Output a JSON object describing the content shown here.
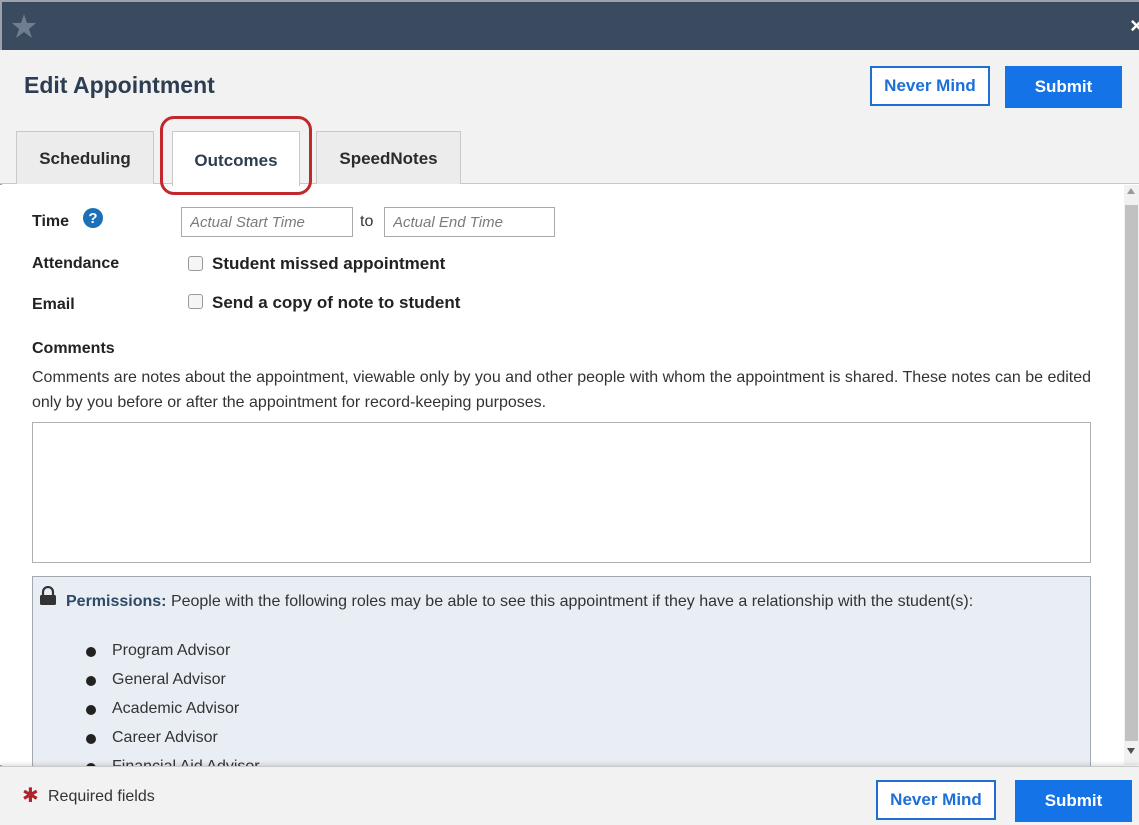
{
  "window": {
    "logo_icon": "star-logo-icon",
    "close_label": "×"
  },
  "header": {
    "title": "Edit Appointment",
    "never_mind_label": "Never Mind",
    "submit_label": "Submit",
    "accent_color": "#1473e6",
    "bar_color": "#3a4a5f"
  },
  "tabs": [
    {
      "label": "Scheduling",
      "active": false
    },
    {
      "label": "Outcomes",
      "active": true
    },
    {
      "label": "SpeedNotes",
      "active": false
    }
  ],
  "form": {
    "time": {
      "label": "Time",
      "help_icon": "question-circle-icon",
      "start_placeholder": "Actual Start Time",
      "to_word": "to",
      "end_placeholder": "Actual End Time"
    },
    "attendance": {
      "label": "Attendance",
      "checkbox_label": "Student missed appointment",
      "checked": false
    },
    "email": {
      "label": "Email",
      "checkbox_label": "Send a copy of note to student",
      "checked": false
    },
    "comments": {
      "title": "Comments",
      "description": "Comments are notes about the appointment, viewable only by you and other people with whom the appointment is shared. These notes can be edited only by you before or after the appointment for record-keeping purposes.",
      "value": ""
    },
    "permissions": {
      "lock_icon": "lock-icon",
      "heading": "Permissions:",
      "text": "People with the following roles may be able to see this appointment if they have a relationship with the student(s):",
      "roles": [
        "Program Advisor",
        "General Advisor",
        "Academic Advisor",
        "Career Advisor",
        "Financial Aid Advisor"
      ]
    }
  },
  "footer": {
    "required_marker": "✱",
    "required_text": "Required fields",
    "never_mind_label": "Never Mind",
    "submit_label": "Submit"
  }
}
